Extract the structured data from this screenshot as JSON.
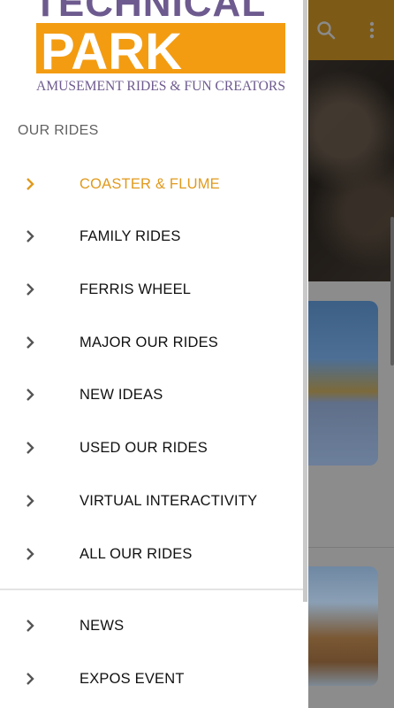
{
  "background": {
    "toolbar_color": "#7d5a16",
    "icons": [
      "search-icon",
      "more-vert-icon"
    ]
  },
  "drawer": {
    "logo": {
      "line1": "TECHNICAL",
      "line2": "PARK",
      "tagline": "AMUSEMENT RIDES & FUN CREATORS",
      "brand_orange": "#f39c12",
      "brand_purple": "#6d5a8e"
    },
    "section_title": "OUR RIDES",
    "accent_color": "#e09a1c",
    "items": [
      {
        "label": "COASTER & FLUME",
        "active": true
      },
      {
        "label": "FAMILY RIDES"
      },
      {
        "label": "FERRIS WHEEL"
      },
      {
        "label": "MAJOR OUR RIDES"
      },
      {
        "label": "NEW IDEAS"
      },
      {
        "label": "USED OUR RIDES"
      },
      {
        "label": "VIRTUAL INTERACTIVITY"
      },
      {
        "label": "ALL OUR RIDES"
      }
    ],
    "secondary_items": [
      {
        "label": "NEWS"
      },
      {
        "label": "EXPOS EVENT"
      }
    ]
  }
}
